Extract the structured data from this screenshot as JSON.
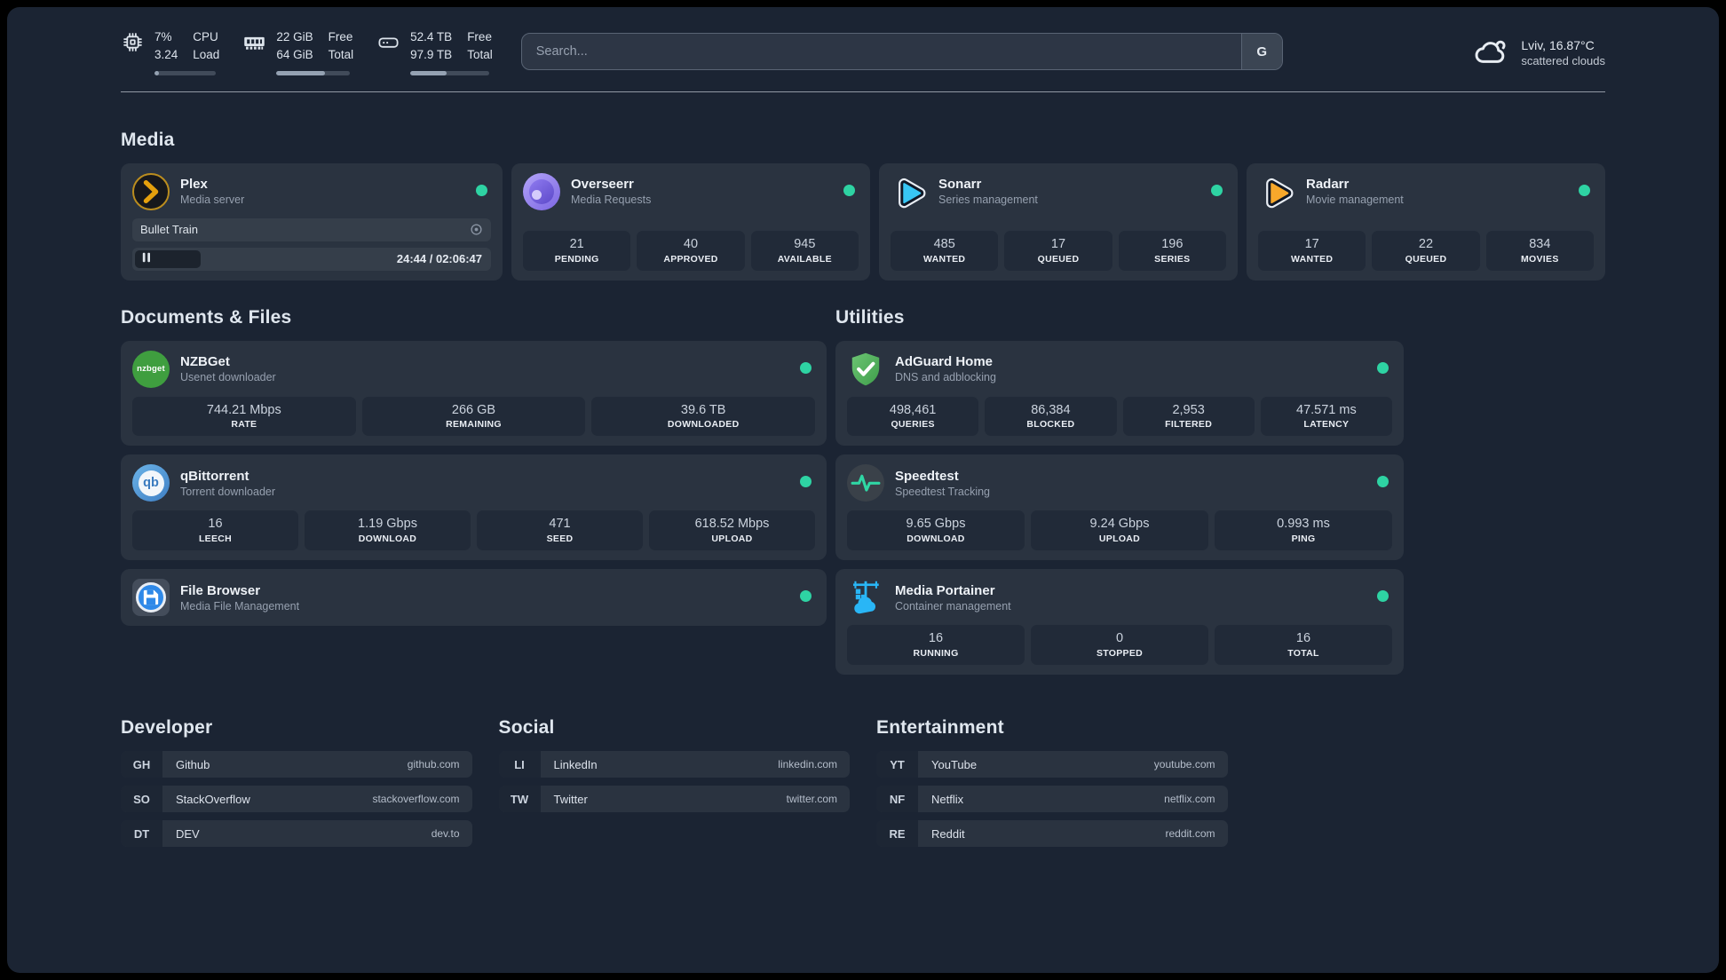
{
  "header": {
    "resources": [
      {
        "icon": "cpu-icon",
        "values": [
          "7%",
          "3.24"
        ],
        "labels": [
          "CPU",
          "Load"
        ],
        "progress_pct": 7
      },
      {
        "icon": "memory-icon",
        "values": [
          "22 GiB",
          "64 GiB"
        ],
        "labels": [
          "Free",
          "Total"
        ],
        "progress_pct": 66
      },
      {
        "icon": "disk-icon",
        "values": [
          "52.4 TB",
          "97.9 TB"
        ],
        "labels": [
          "Free",
          "Total"
        ],
        "progress_pct": 46
      }
    ],
    "search": {
      "placeholder": "Search...",
      "provider_button": "G"
    },
    "weather": {
      "icon": "cloud-icon",
      "location_temp": "Lviv, 16.87°C",
      "condition": "scattered clouds"
    }
  },
  "groups": [
    {
      "id": "media",
      "title": "Media",
      "cards": [
        {
          "icon": "plex-icon",
          "title": "Plex",
          "subtitle": "Media server",
          "status_dot": true,
          "player": {
            "track": "Bullet Train",
            "time": "24:44 / 02:06:47",
            "state": "paused"
          },
          "stats": []
        },
        {
          "icon": "overseerr-icon",
          "title": "Overseerr",
          "subtitle": "Media Requests",
          "status_dot": true,
          "stats": [
            {
              "value": "21",
              "label": "PENDING"
            },
            {
              "value": "40",
              "label": "APPROVED"
            },
            {
              "value": "945",
              "label": "AVAILABLE"
            }
          ]
        },
        {
          "icon": "sonarr-icon",
          "title": "Sonarr",
          "subtitle": "Series management",
          "status_dot": true,
          "stats": [
            {
              "value": "485",
              "label": "WANTED"
            },
            {
              "value": "17",
              "label": "QUEUED"
            },
            {
              "value": "196",
              "label": "SERIES"
            }
          ]
        },
        {
          "icon": "radarr-icon",
          "title": "Radarr",
          "subtitle": "Movie management",
          "status_dot": true,
          "stats": [
            {
              "value": "17",
              "label": "WANTED"
            },
            {
              "value": "22",
              "label": "QUEUED"
            },
            {
              "value": "834",
              "label": "MOVIES"
            }
          ]
        }
      ]
    },
    {
      "id": "documents",
      "title": "Documents & Files",
      "cards": [
        {
          "icon": "nzbget-icon",
          "title": "NZBGet",
          "subtitle": "Usenet downloader",
          "status_dot": true,
          "stats": [
            {
              "value": "744.21 Mbps",
              "label": "RATE"
            },
            {
              "value": "266 GB",
              "label": "REMAINING"
            },
            {
              "value": "39.6 TB",
              "label": "DOWNLOADED"
            }
          ]
        },
        {
          "icon": "qbittorrent-icon",
          "title": "qBittorrent",
          "subtitle": "Torrent downloader",
          "status_dot": true,
          "stats": [
            {
              "value": "16",
              "label": "LEECH"
            },
            {
              "value": "1.19 Gbps",
              "label": "DOWNLOAD"
            },
            {
              "value": "471",
              "label": "SEED"
            },
            {
              "value": "618.52 Mbps",
              "label": "UPLOAD"
            }
          ]
        },
        {
          "icon": "filebrowser-icon",
          "title": "File Browser",
          "subtitle": "Media File Management",
          "status_dot": true,
          "stats": []
        }
      ]
    },
    {
      "id": "utilities",
      "title": "Utilities",
      "cards": [
        {
          "icon": "adguard-icon",
          "title": "AdGuard Home",
          "subtitle": "DNS and adblocking",
          "status_dot": true,
          "stats": [
            {
              "value": "498,461",
              "label": "QUERIES"
            },
            {
              "value": "86,384",
              "label": "BLOCKED"
            },
            {
              "value": "2,953",
              "label": "FILTERED"
            },
            {
              "value": "47.571 ms",
              "label": "LATENCY"
            }
          ]
        },
        {
          "icon": "speedtest-icon",
          "title": "Speedtest",
          "subtitle": "Speedtest Tracking",
          "status_dot": true,
          "stats": [
            {
              "value": "9.65 Gbps",
              "label": "DOWNLOAD"
            },
            {
              "value": "9.24 Gbps",
              "label": "UPLOAD"
            },
            {
              "value": "0.993 ms",
              "label": "PING"
            }
          ]
        },
        {
          "icon": "portainer-icon",
          "title": "Media Portainer",
          "subtitle": "Container management",
          "status_dot": true,
          "stats": [
            {
              "value": "16",
              "label": "RUNNING"
            },
            {
              "value": "0",
              "label": "STOPPED"
            },
            {
              "value": "16",
              "label": "TOTAL"
            }
          ]
        }
      ]
    }
  ],
  "bookmarks": [
    {
      "title": "Developer",
      "links": [
        {
          "abbr": "GH",
          "name": "Github",
          "url": "github.com"
        },
        {
          "abbr": "SO",
          "name": "StackOverflow",
          "url": "stackoverflow.com"
        },
        {
          "abbr": "DT",
          "name": "DEV",
          "url": "dev.to"
        }
      ]
    },
    {
      "title": "Social",
      "links": [
        {
          "abbr": "LI",
          "name": "LinkedIn",
          "url": "linkedin.com"
        },
        {
          "abbr": "TW",
          "name": "Twitter",
          "url": "twitter.com"
        }
      ]
    },
    {
      "title": "Entertainment",
      "links": [
        {
          "abbr": "YT",
          "name": "YouTube",
          "url": "youtube.com"
        },
        {
          "abbr": "NF",
          "name": "Netflix",
          "url": "netflix.com"
        },
        {
          "abbr": "RE",
          "name": "Reddit",
          "url": "reddit.com"
        }
      ]
    }
  ],
  "colors": {
    "background": "#1b2433",
    "card": "#2a3340",
    "stat_pill": "#212a38",
    "status_green": "#2ed3a3",
    "text_primary": "#eef2f7",
    "text_secondary": "#96a0af"
  }
}
